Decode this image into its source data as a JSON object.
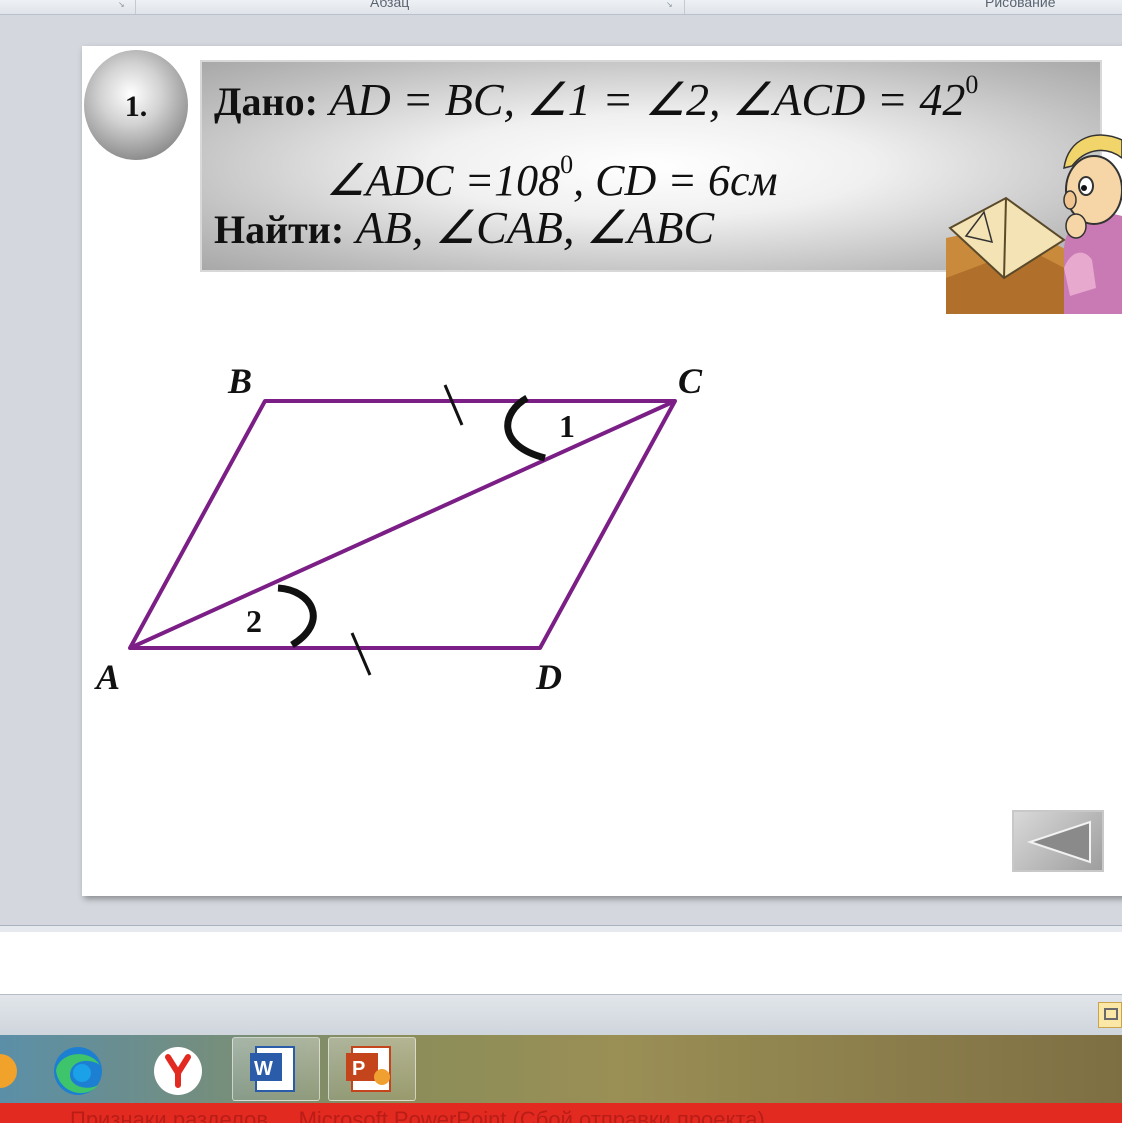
{
  "ribbon": {
    "groups": [
      "Абзац",
      "Рисование"
    ]
  },
  "slide": {
    "number": "1.",
    "given_label": "Дано:",
    "given_line1": "AD = BC, ∠1 = ∠2, ∠ACD = 42",
    "given_line1_sup": "0",
    "given_line2_a": "∠ADC =108",
    "given_line2_sup": "0",
    "given_line2_b": ", CD = 6см",
    "find_label": "Найти:",
    "find_line": "AB, ∠CAB, ∠ABC",
    "diagram": {
      "points": {
        "A": "A",
        "B": "B",
        "C": "C",
        "D": "D"
      },
      "angles": {
        "one": "1",
        "two": "2"
      },
      "stroke_color": "#7b1f86"
    },
    "back_button_icon": "triangle-left-icon"
  },
  "taskbar": {
    "apps": [
      "edge-icon",
      "yandex-browser-icon",
      "word-icon",
      "powerpoint-icon"
    ]
  },
  "error_bar": {
    "text": "Признаки разделов ... Microsoft PowerPoint (Сбой отправки проекта)"
  }
}
